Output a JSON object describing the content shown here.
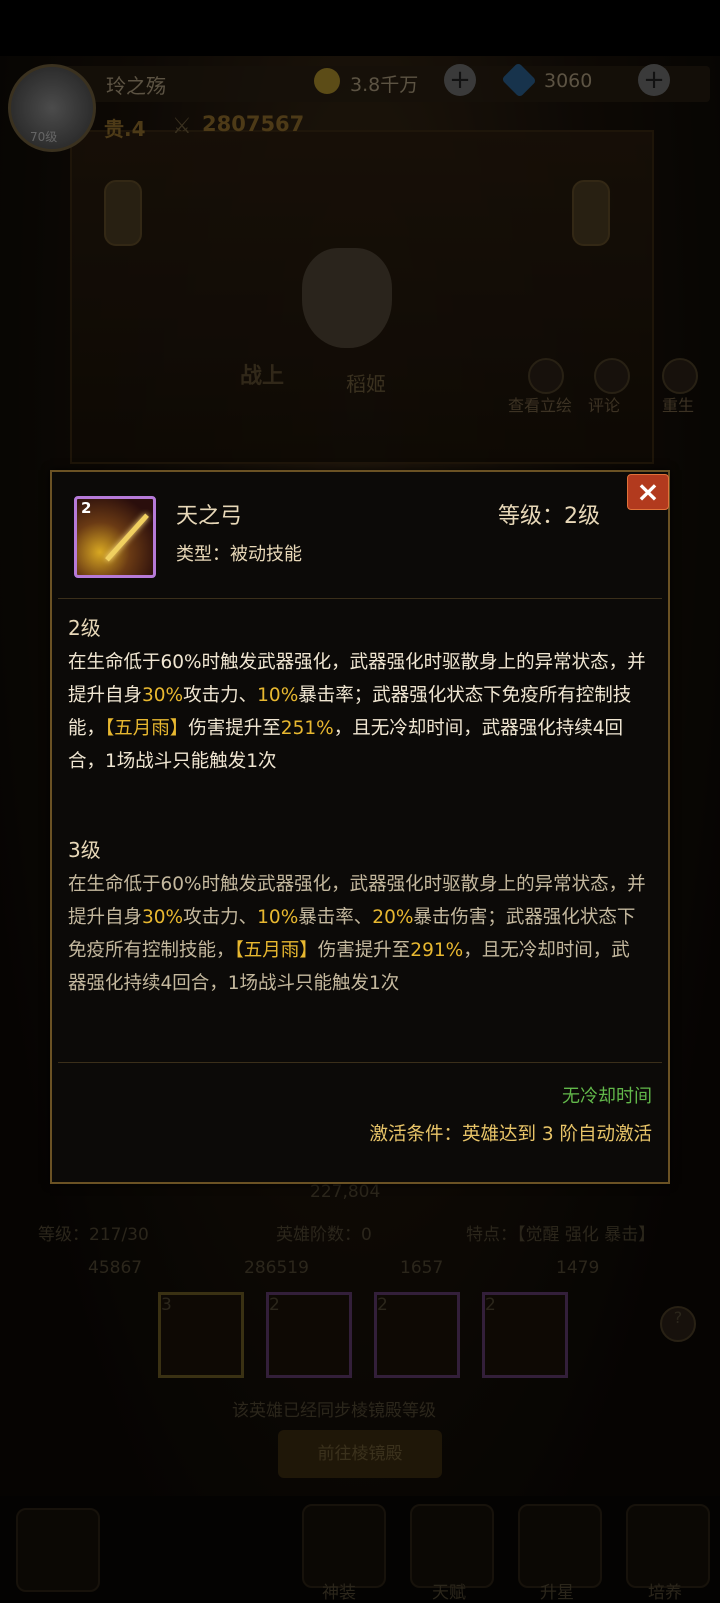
{
  "hud": {
    "player_name": "玲之殇",
    "avatar_level": "70级",
    "gold": "3.8千万",
    "gems": "3060",
    "vip": "贵.4",
    "power": "2807567"
  },
  "scene": {
    "battle_badge": "战上",
    "hero_name": "稻姬",
    "tools": [
      "查看立绘",
      "评论",
      "重生"
    ]
  },
  "popup": {
    "skill_icon_level": "2",
    "skill_name": "天之弓",
    "skill_type": "类型：被动技能",
    "skill_level": "等级：2级",
    "level2_head": "2级",
    "level2_desc": [
      {
        "t": "在生命低于60%时触发武器强化，武器强化时驱散身上的异常状态，并提升自身"
      },
      {
        "t": "30%",
        "hl": true
      },
      {
        "t": "攻击力、"
      },
      {
        "t": "10%",
        "hl": true
      },
      {
        "t": "暴击率；武器强化状态下免疫所有控制技能，"
      },
      {
        "t": "【五月雨】",
        "hl": true
      },
      {
        "t": "伤害提升至"
      },
      {
        "t": "251%",
        "hl": true
      },
      {
        "t": "，且无冷却时间，武器强化持续4回合，1场战斗只能触发1次"
      }
    ],
    "level3_head": "3级",
    "level3_desc": [
      {
        "t": "在生命低于60%时触发武器强化，武器强化时驱散身上的异常状态，并提升自身"
      },
      {
        "t": "30%",
        "hl": true
      },
      {
        "t": "攻击力、"
      },
      {
        "t": "10%",
        "hl": true
      },
      {
        "t": "暴击率、"
      },
      {
        "t": "20%",
        "hl": true
      },
      {
        "t": "暴击伤害；武器强化状态下免疫所有控制技能，"
      },
      {
        "t": "【五月雨】",
        "hl": true
      },
      {
        "t": "伤害提升至"
      },
      {
        "t": "291%",
        "hl": true
      },
      {
        "t": "，且无冷却时间，武器强化持续4回合，1场战斗只能触发1次"
      }
    ],
    "cooldown": "无冷却时间",
    "activation": "激活条件：英雄达到 3 阶自动激活",
    "close": "×"
  },
  "bottom": {
    "power_value": "227,804",
    "level": "等级：217/30",
    "rank": "英雄阶数：0",
    "traits": "特点：【觉醒 强化 暴击】",
    "stats": [
      "45867",
      "286519",
      "1657",
      "1479"
    ],
    "skill_levels": [
      "3",
      "2",
      "2",
      "2"
    ],
    "sync_note": "该英雄已经同步棱镜殿等级",
    "goto_button": "前往棱镜殿",
    "nav": [
      "神装",
      "天赋",
      "升星",
      "培养"
    ]
  }
}
